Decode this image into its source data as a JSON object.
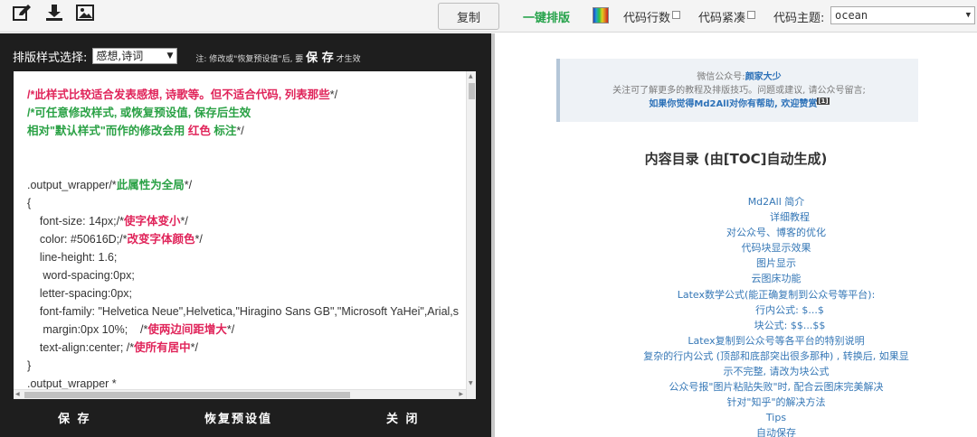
{
  "toolbar": {
    "icons": [
      "edit-icon",
      "download-icon",
      "image-icon"
    ],
    "copy_label": "复制",
    "onekey_label": "一键排版",
    "line_numbers_label": "代码行数",
    "compact_label": "代码紧凑",
    "theme_label": "代码主题:",
    "theme_value": "ocean"
  },
  "editor_panel": {
    "style_label": "排版样式选择:",
    "style_value": "感想,诗词",
    "note_prefix": "注: 修改或\"恢复预设值\"后, 要",
    "note_bold": "保 存",
    "note_suffix": "才生效",
    "code_lines": [
      [
        {
          "t": "/*",
          "c": "red"
        },
        {
          "t": "此样式比较适合发表感想, 诗歌等。但不适合代码, 列表那些",
          "c": "red"
        },
        {
          "t": "*/",
          "c": ""
        }
      ],
      [
        {
          "t": "/*",
          "c": "green"
        },
        {
          "t": "可任意修改样式, 或恢复预设值, 保存后生效",
          "c": "green"
        }
      ],
      [
        {
          "t": "相对\"默认样式\"而作的修改会用",
          "c": "green"
        },
        {
          "t": " 红色 ",
          "c": "red"
        },
        {
          "t": "标注",
          "c": "green"
        },
        {
          "t": "*/",
          "c": ""
        }
      ],
      [],
      [],
      [
        {
          "t": ".output_wrapper/*",
          "c": ""
        },
        {
          "t": "此属性为全局",
          "c": "green"
        },
        {
          "t": "*/",
          "c": ""
        }
      ],
      [
        {
          "t": "{",
          "c": ""
        }
      ],
      [
        {
          "t": "    font-size: 14px;/*",
          "c": ""
        },
        {
          "t": "使字体变小",
          "c": "red"
        },
        {
          "t": "*/",
          "c": ""
        }
      ],
      [
        {
          "t": "    color: #50616D;/*",
          "c": ""
        },
        {
          "t": "改变字体颜色",
          "c": "red"
        },
        {
          "t": "*/",
          "c": ""
        }
      ],
      [
        {
          "t": "    line-height: 1.6;",
          "c": ""
        }
      ],
      [
        {
          "t": "     word-spacing:0px;",
          "c": ""
        }
      ],
      [
        {
          "t": "    letter-spacing:0px;",
          "c": ""
        }
      ],
      [
        {
          "t": "    font-family: \"Helvetica Neue\",Helvetica,\"Hiragino Sans GB\",\"Microsoft YaHei\",Arial,s",
          "c": ""
        }
      ],
      [
        {
          "t": "     margin:0px 10%;    /*",
          "c": ""
        },
        {
          "t": "使两边间距增大",
          "c": "red"
        },
        {
          "t": "*/",
          "c": ""
        }
      ],
      [
        {
          "t": "    text-align:center; /*",
          "c": ""
        },
        {
          "t": "使所有居中",
          "c": "red"
        },
        {
          "t": "*/",
          "c": ""
        }
      ],
      [
        {
          "t": "}",
          "c": ""
        }
      ],
      [
        {
          "t": ".output_wrapper *",
          "c": ""
        }
      ]
    ],
    "save_label": "保 存",
    "restore_label": "恢复预设值",
    "close_label": "关 闭"
  },
  "preview": {
    "notice_line1_prefix": "微信公众号:",
    "notice_line1_name": "颜家大少",
    "notice_line2": "关注可了解更多的教程及排版技巧。问题或建议, 请公众号留言;",
    "notice_line3": "如果你觉得Md2All对你有帮助, 欢迎赞赏",
    "notice_sup": "[1]",
    "toc_title": "内容目录 (由[TOC]自动生成)",
    "toc_items": [
      "Md2All 简介",
      "详细教程",
      "对公众号、博客的优化",
      "代码块显示效果",
      "图片显示",
      "云图床功能",
      "Latex数学公式(能正确复制到公众号等平台):",
      "行内公式: $...$",
      "块公式: $$...$$",
      "Latex复制到公众号等各平台的特别说明",
      "复杂的行内公式 (顶部和底部突出很多那种) , 转换后, 如果显",
      "示不完整, 请改为块公式",
      "公众号报\"图片粘贴失败\"时, 配合云图床完美解决",
      "针对\"知乎\"的解决方法",
      "Tips",
      "自动保存"
    ]
  }
}
